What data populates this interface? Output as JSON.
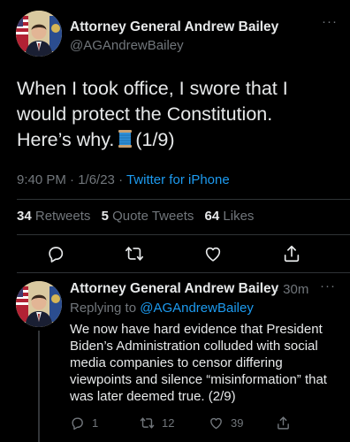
{
  "main_tweet": {
    "author_name": "Attorney General Andrew Bailey",
    "handle": "@AGAndrewBailey",
    "text_line1": "When I took office, I swore that I",
    "text_line2": "would protect the Constitution.",
    "text_line3_pre": "Here’s why.",
    "text_line3_post": "(1/9)",
    "emoji": "spool-of-thread",
    "time": "9:40 PM · 1/6/23 ·",
    "source": "Twitter for iPhone",
    "retweets_count": "34",
    "retweets_label": "Retweets",
    "quotes_count": "5",
    "quotes_label": "Quote Tweets",
    "likes_count": "64",
    "likes_label": "Likes",
    "more": "···"
  },
  "reply_tweet": {
    "author_name": "Attorney General Andrew Bailey",
    "time": "· 30m",
    "replying_label": "Replying to",
    "replying_handle": "@AGAndrewBailey",
    "text": "We now have hard evidence that President Biden’s Administration colluded with social media companies to censor differing viewpoints and silence “misinformation” that was later deemed true. (2/9)",
    "reply_count": "1",
    "retweet_count": "12",
    "like_count": "39",
    "more": "···"
  },
  "colors": {
    "background": "#000000",
    "text": "#e7e9ea",
    "muted": "#71767b",
    "link": "#1d9bf0",
    "divider": "#2f3336"
  }
}
